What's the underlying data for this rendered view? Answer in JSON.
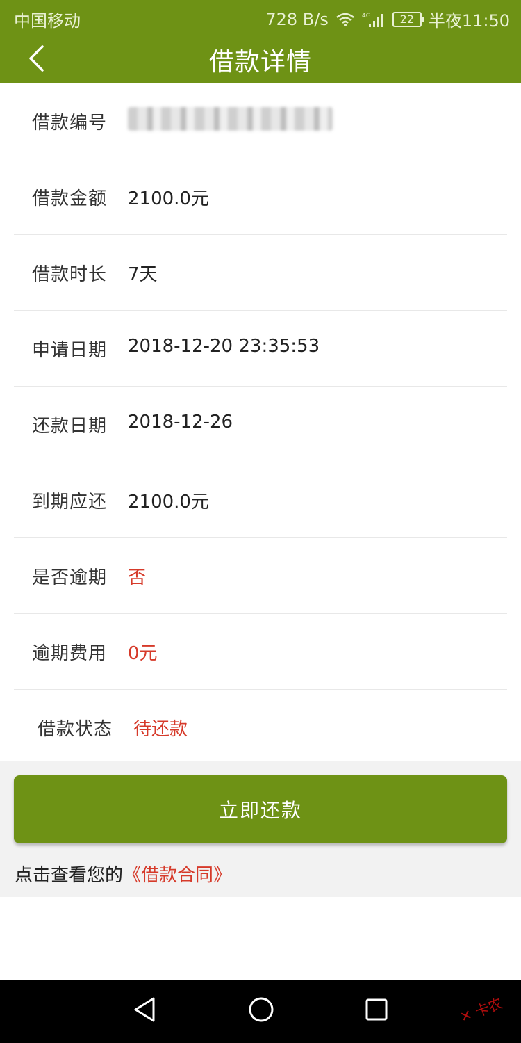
{
  "status_bar": {
    "carrier": "中国移动",
    "speed": "728 B/s",
    "network": "4G",
    "battery": "22",
    "time": "半夜11:50"
  },
  "header": {
    "title": "借款详情",
    "back_icon": "chevron-left-icon"
  },
  "details": [
    {
      "label": "借款编号",
      "value": ""
    },
    {
      "label": "借款金额",
      "value": "2100.0元"
    },
    {
      "label": "借款时长",
      "value": "7天"
    },
    {
      "label": "申请日期",
      "value": "2018-12-20 23:35:53"
    },
    {
      "label": "还款日期",
      "value": "2018-12-26"
    },
    {
      "label": "到期应还",
      "value": "2100.0元"
    },
    {
      "label": "是否逾期",
      "value": "否"
    },
    {
      "label": "逾期费用",
      "value": "0元"
    },
    {
      "label": "借款状态",
      "value": "待还款"
    }
  ],
  "actions": {
    "repay_label": "立即还款",
    "contract_prefix": "点击查看您的",
    "contract_link": "《借款合同》"
  },
  "colors": {
    "brand_green": "#6e9215",
    "accent_red": "#d63a2a"
  }
}
